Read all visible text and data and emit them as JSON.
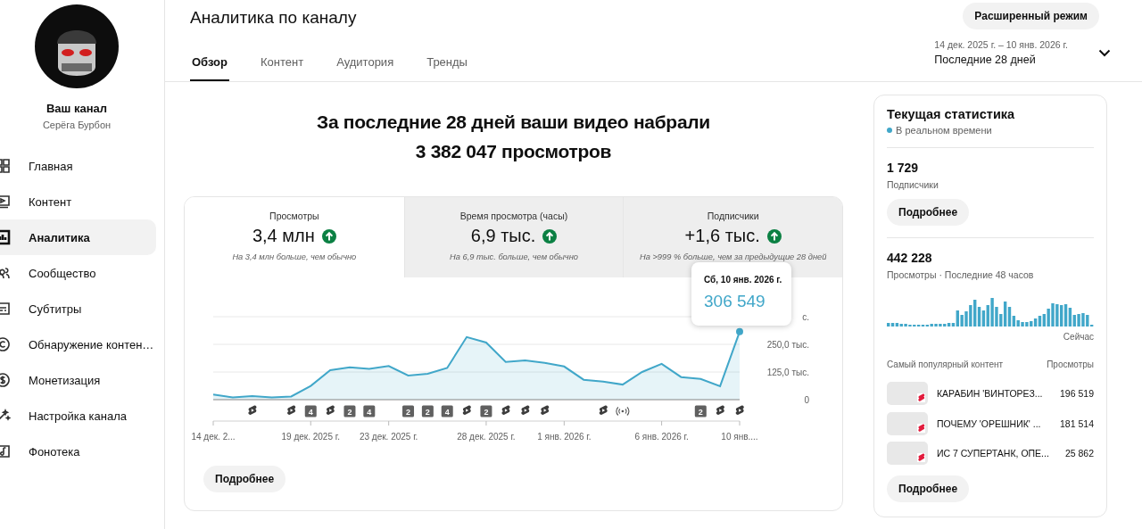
{
  "sidebar": {
    "channel_label": "Ваш канал",
    "channel_name": "Серёга Бурбон",
    "items": [
      {
        "label": "Главная",
        "selected": false
      },
      {
        "label": "Контент",
        "selected": false
      },
      {
        "label": "Аналитика",
        "selected": true
      },
      {
        "label": "Сообщество",
        "selected": false
      },
      {
        "label": "Субтитры",
        "selected": false
      },
      {
        "label": "Обнаружение контен…",
        "selected": false
      },
      {
        "label": "Монетизация",
        "selected": false
      },
      {
        "label": "Настройка канала",
        "selected": false
      },
      {
        "label": "Фонотека",
        "selected": false
      }
    ]
  },
  "header": {
    "title": "Аналитика по каналу",
    "tabs": [
      {
        "label": "Обзор",
        "selected": true
      },
      {
        "label": "Контент",
        "selected": false
      },
      {
        "label": "Аудитория",
        "selected": false
      },
      {
        "label": "Тренды",
        "selected": false
      }
    ],
    "advanced_button": "Расширенный режим",
    "date_range": "14 дек. 2025 г. – 10 янв. 2026 г.",
    "period": "Последние 28 дней"
  },
  "headline": {
    "text": "За последние 28 дней ваши видео набрали",
    "total": "3 382 047 просмотров"
  },
  "metrics": [
    {
      "title": "Просмотры",
      "value": "3,4 млн",
      "note": "На 3,4 млн больше, чем обычно",
      "selected": true
    },
    {
      "title": "Время просмотра (часы)",
      "value": "6,9 тыс.",
      "note": "На 6,9 тыс. больше, чем обычно",
      "selected": false
    },
    {
      "title": "Подписчики",
      "value": "+1,6 тыс.",
      "note": "На >999 % больше, чем за предыдущие 28 дней",
      "selected": false
    }
  ],
  "chart": {
    "chart_data": {
      "type": "area",
      "categories": [
        "14 дек. 2...",
        null,
        null,
        null,
        null,
        "19 дек. 2025 г.",
        null,
        null,
        null,
        "23 дек. 2025 г.",
        null,
        null,
        null,
        null,
        "28 дек. 2025 г.",
        null,
        null,
        null,
        "1 янв. 2026 г.",
        null,
        null,
        null,
        null,
        "6 янв. 2026 г.",
        null,
        null,
        null,
        "10 янв...."
      ],
      "series": [
        {
          "color": "#41a7c9",
          "values": [
            23,
            10,
            16,
            10,
            14,
            62,
            133,
            146,
            139,
            152,
            109,
            117,
            143,
            283,
            258,
            170,
            178,
            166,
            150,
            90,
            82,
            68,
            125,
            162,
            102,
            94,
            61,
            307
          ]
        }
      ],
      "ylim": [
        0,
        375
      ],
      "yticks": [
        {
          "value": 0,
          "label": "0"
        },
        {
          "value": 125,
          "label": "125,0 тыс."
        },
        {
          "value": 250,
          "label": "250,0 тыс."
        },
        {
          "value": 375,
          "label": "с."
        }
      ]
    },
    "markers": [
      {
        "kind": "none"
      },
      {
        "kind": "none"
      },
      {
        "kind": "shorts"
      },
      {
        "kind": "none"
      },
      {
        "kind": "shorts"
      },
      {
        "kind": "count",
        "label": "4"
      },
      {
        "kind": "shorts"
      },
      {
        "kind": "count",
        "label": "2"
      },
      {
        "kind": "count",
        "label": "4"
      },
      {
        "kind": "none"
      },
      {
        "kind": "count",
        "label": "2"
      },
      {
        "kind": "count",
        "label": "2"
      },
      {
        "kind": "count",
        "label": "4"
      },
      {
        "kind": "shorts"
      },
      {
        "kind": "count",
        "label": "2"
      },
      {
        "kind": "shorts"
      },
      {
        "kind": "shorts"
      },
      {
        "kind": "shorts"
      },
      {
        "kind": "none"
      },
      {
        "kind": "none"
      },
      {
        "kind": "shorts"
      },
      {
        "kind": "live"
      },
      {
        "kind": "none"
      },
      {
        "kind": "none"
      },
      {
        "kind": "none"
      },
      {
        "kind": "count",
        "label": "2"
      },
      {
        "kind": "shorts"
      },
      {
        "kind": "shorts"
      }
    ],
    "tooltip": {
      "date": "Сб, 10 янв. 2026 г.",
      "value": "306 549"
    },
    "more_button": "Подробнее"
  },
  "realtime": {
    "title": "Текущая статистика",
    "live_label": "В реальном времени",
    "subscribers": {
      "value": "1 729",
      "label": "Подписчики"
    },
    "subscribers_button": "Подробнее",
    "views": {
      "value": "442 228",
      "label": "Просмотры · Последние 48 часов"
    },
    "now_label": "Сейчас",
    "top_header": "Самый популярный контент",
    "top_views_header": "Просмотры",
    "top": [
      {
        "title": "КАРАБИН 'ВИНТОРЕЗ...",
        "views": "196 519"
      },
      {
        "title": "ПОЧЕМУ 'ОРЕШНИК' ...",
        "views": "181 514"
      },
      {
        "title": "ИС 7 СУПЕРТАНК, ОПЕ...",
        "views": "25 862"
      }
    ],
    "more_button": "Подробнее"
  }
}
